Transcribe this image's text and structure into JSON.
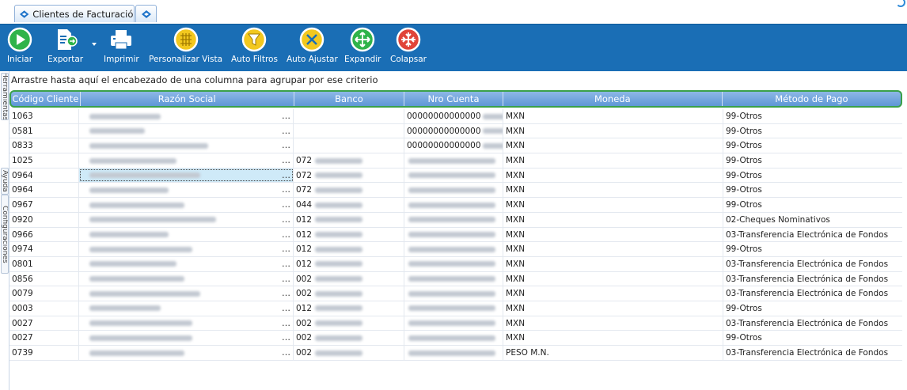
{
  "tabs": [
    {
      "label": "Clientes de Facturación",
      "active": true
    },
    {
      "label": "",
      "active": false
    }
  ],
  "toolbar": [
    {
      "id": "iniciar",
      "label": "Iniciar",
      "icon": "play-icon"
    },
    {
      "id": "exportar",
      "label": "Exportar",
      "icon": "export-icon"
    },
    {
      "id": "imprimir",
      "label": "Imprimir",
      "icon": "printer-icon"
    },
    {
      "id": "personalizar",
      "label": "Personalizar Vista",
      "icon": "grid-view-icon"
    },
    {
      "id": "autofiltros",
      "label": "Auto Filtros",
      "icon": "filter-icon"
    },
    {
      "id": "autoajustar",
      "label": "Auto Ajustar",
      "icon": "autofit-icon"
    },
    {
      "id": "expandir",
      "label": "Expandir",
      "icon": "expand-icon"
    },
    {
      "id": "colapsar",
      "label": "Colapsar",
      "icon": "collapse-icon"
    }
  ],
  "side_tabs": [
    "Herramientas",
    "Ayuda",
    "Configuraciones"
  ],
  "grid": {
    "group_hint": "Arrastre hasta aquí el encabezado de una columna para agrupar por ese criterio",
    "columns": [
      "Código Cliente",
      "Razón Social",
      "Banco",
      "Nro Cuenta",
      "Moneda",
      "Método de Pago"
    ],
    "rows": [
      {
        "codigo": "1063",
        "banco": "",
        "cuenta": "00000000000000",
        "moneda": "MXN",
        "metodo": "99-Otros"
      },
      {
        "codigo": "0581",
        "banco": "",
        "cuenta": "00000000000000",
        "moneda": "MXN",
        "metodo": "99-Otros"
      },
      {
        "codigo": "0833",
        "banco": "",
        "cuenta": "00000000000000",
        "moneda": "MXN",
        "metodo": "99-Otros"
      },
      {
        "codigo": "1025",
        "banco": "072",
        "cuenta": "",
        "moneda": "MXN",
        "metodo": "99-Otros"
      },
      {
        "codigo": "0964",
        "banco": "072",
        "cuenta": "",
        "moneda": "MXN",
        "metodo": "99-Otros",
        "selected": true
      },
      {
        "codigo": "0964",
        "banco": "072",
        "cuenta": "",
        "moneda": "MXN",
        "metodo": "99-Otros"
      },
      {
        "codigo": "0967",
        "banco": "044",
        "cuenta": "",
        "moneda": "MXN",
        "metodo": "99-Otros"
      },
      {
        "codigo": "0920",
        "banco": "012",
        "cuenta": "",
        "moneda": "MXN",
        "metodo": "02-Cheques Nominativos"
      },
      {
        "codigo": "0966",
        "banco": "012",
        "cuenta": "",
        "moneda": "MXN",
        "metodo": "03-Transferencia Electrónica de Fondos"
      },
      {
        "codigo": "0974",
        "banco": "012",
        "cuenta": "",
        "moneda": "MXN",
        "metodo": "99-Otros"
      },
      {
        "codigo": "0801",
        "banco": "012",
        "cuenta": "",
        "moneda": "MXN",
        "metodo": "03-Transferencia Electrónica de Fondos"
      },
      {
        "codigo": "0856",
        "banco": "002",
        "cuenta": "",
        "moneda": "MXN",
        "metodo": "03-Transferencia Electrónica de Fondos"
      },
      {
        "codigo": "0079",
        "banco": "002",
        "cuenta": "",
        "moneda": "MXN",
        "metodo": "03-Transferencia Electrónica de Fondos"
      },
      {
        "codigo": "0003",
        "banco": "012",
        "cuenta": "",
        "moneda": "MXN",
        "metodo": "99-Otros"
      },
      {
        "codigo": "0027",
        "banco": "002",
        "cuenta": "",
        "moneda": "MXN",
        "metodo": "03-Transferencia Electrónica de Fondos"
      },
      {
        "codigo": "0027",
        "banco": "002",
        "cuenta": "",
        "moneda": "MXN",
        "metodo": "99-Otros"
      },
      {
        "codigo": "0739",
        "banco": "002",
        "cuenta": "",
        "moneda": "PESO M.N.",
        "metodo": "03-Transferencia Electrónica de Fondos"
      }
    ]
  },
  "colors": {
    "ribbon": "#1a6eb5",
    "header": "#5e97d6",
    "header_outline": "#3aa04a",
    "selection": "#cfeaf8"
  }
}
